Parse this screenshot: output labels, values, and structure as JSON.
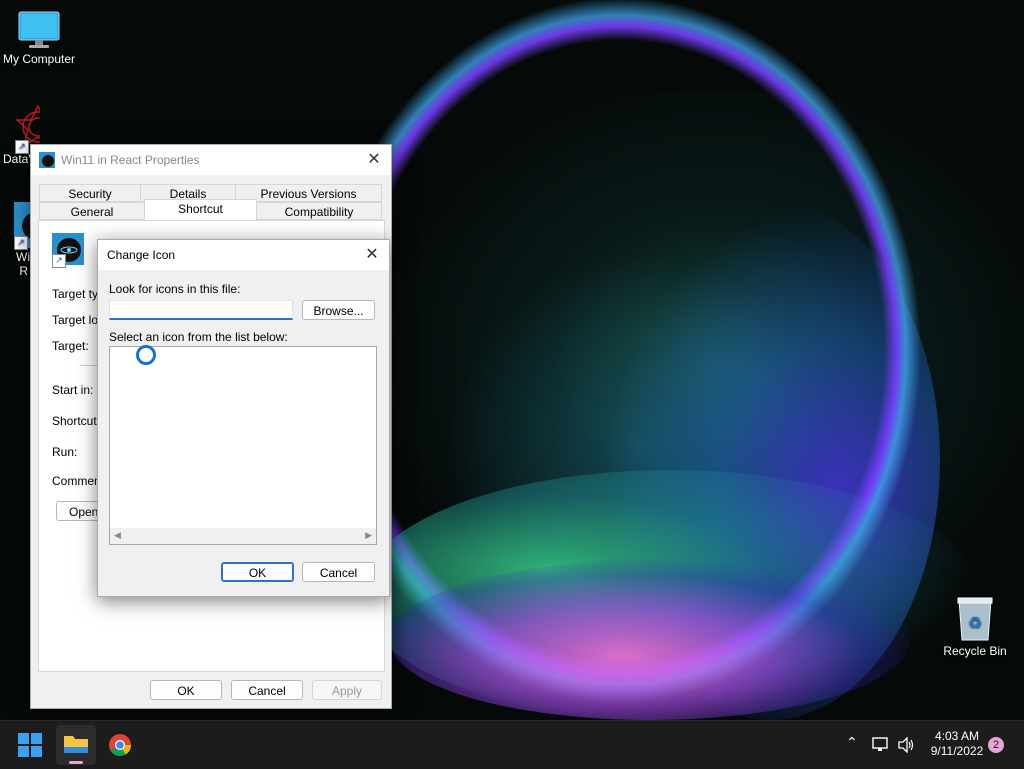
{
  "desktop": {
    "icons": [
      {
        "label": "My Computer"
      },
      {
        "label": "DataV"
      },
      {
        "label": "Wi\nR"
      },
      {
        "label": "Recycle Bin"
      }
    ]
  },
  "props_window": {
    "title": "Win11 in React Properties",
    "tabs_row1": [
      "Security",
      "Details",
      "Previous Versions"
    ],
    "tabs_row2": [
      "General",
      "Shortcut",
      "Compatibility"
    ],
    "fields": [
      "Target typ",
      "Target loc",
      "Target:",
      "Start in:",
      "Shortcut k",
      "Run:",
      "Comment:"
    ],
    "open_button": "Open",
    "ok": "OK",
    "cancel": "Cancel",
    "apply": "Apply"
  },
  "change_icon": {
    "title": "Change Icon",
    "look_label": "Look for icons in this file:",
    "file_value": "",
    "browse": "Browse...",
    "list_label": "Select an icon from the list below:",
    "ok": "OK",
    "cancel": "Cancel"
  },
  "taskbar": {
    "time": "4:03 AM",
    "date": "9/11/2022",
    "notification_count": "2"
  }
}
